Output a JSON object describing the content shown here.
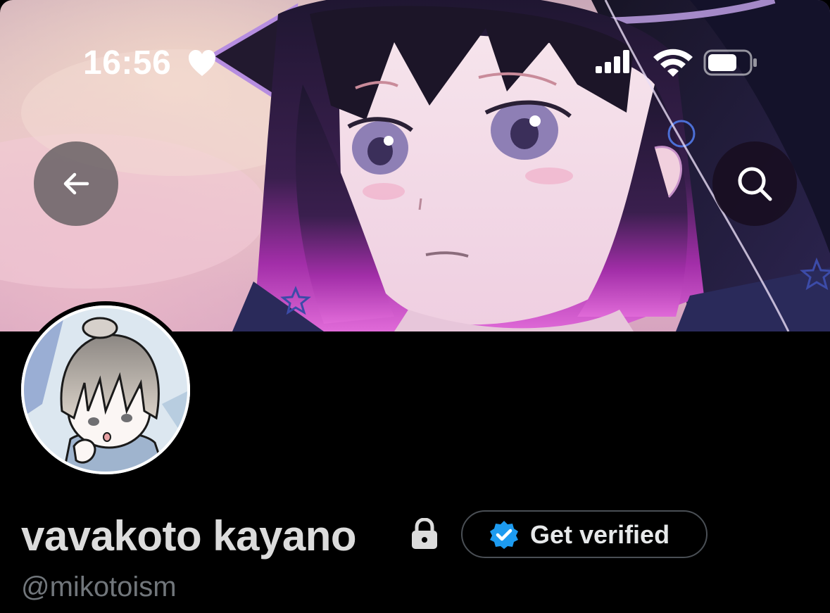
{
  "status_bar": {
    "time": "16:56",
    "heart_icon": "heart-icon",
    "signal_icon": "cellular-signal-icon",
    "wifi_icon": "wifi-icon",
    "battery_icon": "battery-icon"
  },
  "navigation": {
    "back_icon": "arrow-left-icon",
    "search_icon": "search-icon"
  },
  "profile": {
    "display_name": "vavakoto kayano",
    "protected_icon": "lock-icon",
    "handle": "@mikotoism",
    "get_verified_label": "Get verified",
    "verified_badge_color": "#1d9bf0"
  },
  "colors": {
    "background": "#000000",
    "name_text": "#dcdcdc",
    "handle_text": "#71767b",
    "button_border": "#4a4f55"
  }
}
